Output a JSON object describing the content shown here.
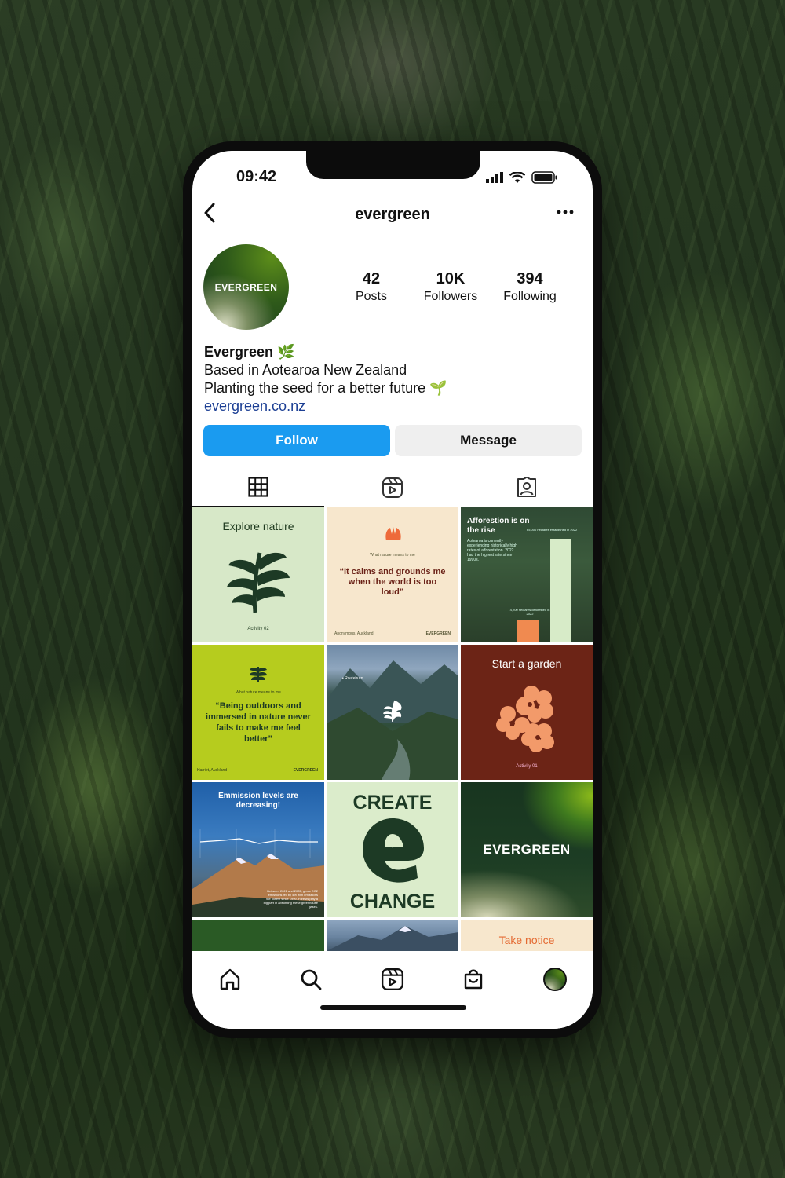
{
  "status": {
    "time": "09:42"
  },
  "header": {
    "username": "evergreen",
    "back_icon": "chevron-left-icon",
    "more_icon": "more-horizontal-icon"
  },
  "profile": {
    "avatar_text": "EVERGREEN",
    "stats": [
      {
        "value": "42",
        "label": "Posts"
      },
      {
        "value": "10K",
        "label": "Followers"
      },
      {
        "value": "394",
        "label": "Following"
      }
    ],
    "name": "Evergreen 🌿",
    "bio_lines": [
      "Based in Aotearoa New Zealand",
      "Planting the seed for a better future 🌱"
    ],
    "link": "evergreen.co.nz"
  },
  "actions": {
    "follow_label": "Follow",
    "message_label": "Message"
  },
  "tabs": [
    "grid-icon",
    "reels-icon",
    "tagged-icon"
  ],
  "posts": {
    "p1": {
      "title": "Explore nature",
      "caption": "Activity 02"
    },
    "p2": {
      "kicker": "What nature means to me",
      "quote": "“It calms and grounds me when the world is too loud”",
      "author": "Anonymous, Auckland",
      "brand": "EVERGREEN"
    },
    "p3": {
      "title": "Afforestion is on the rise",
      "body": "Aotearoa is currently experiencing historically high rates of afforestation. 2022 had the highest rate since 1990s.",
      "top_label": "65,000 hectares established in 2022",
      "bottom_label": "4,200 hectares deforested in 2022"
    },
    "p4": {
      "kicker": "What nature means to me",
      "quote": "“Being outdoors and immersed in nature never fails to make me feel better”",
      "author": "Harriet, Auckland",
      "brand": "EVERGREEN"
    },
    "p5": {
      "tag": "• Routeburn"
    },
    "p6": {
      "title": "Start a garden",
      "caption": "Activity 01"
    },
    "p7": {
      "title": "Emmission levels are decreasing!",
      "body": "Between 2021 and 2022, gross CO2 emissions fell by 4% with emissions the lowest since 1999. Forests play a big part in absorbing these greenhouse gases."
    },
    "p8": {
      "top": "CREATE",
      "bottom": "CHANGE"
    },
    "p9": {
      "brand": "EVERGREEN"
    },
    "p12": {
      "title": "Take notice"
    }
  },
  "nav": [
    "home-icon",
    "search-icon",
    "reels-icon",
    "shop-icon",
    "profile-avatar"
  ],
  "colors": {
    "follow": "#1a9bf0",
    "accent_orange": "#f08a50",
    "brand_green": "#1f3a1f"
  }
}
